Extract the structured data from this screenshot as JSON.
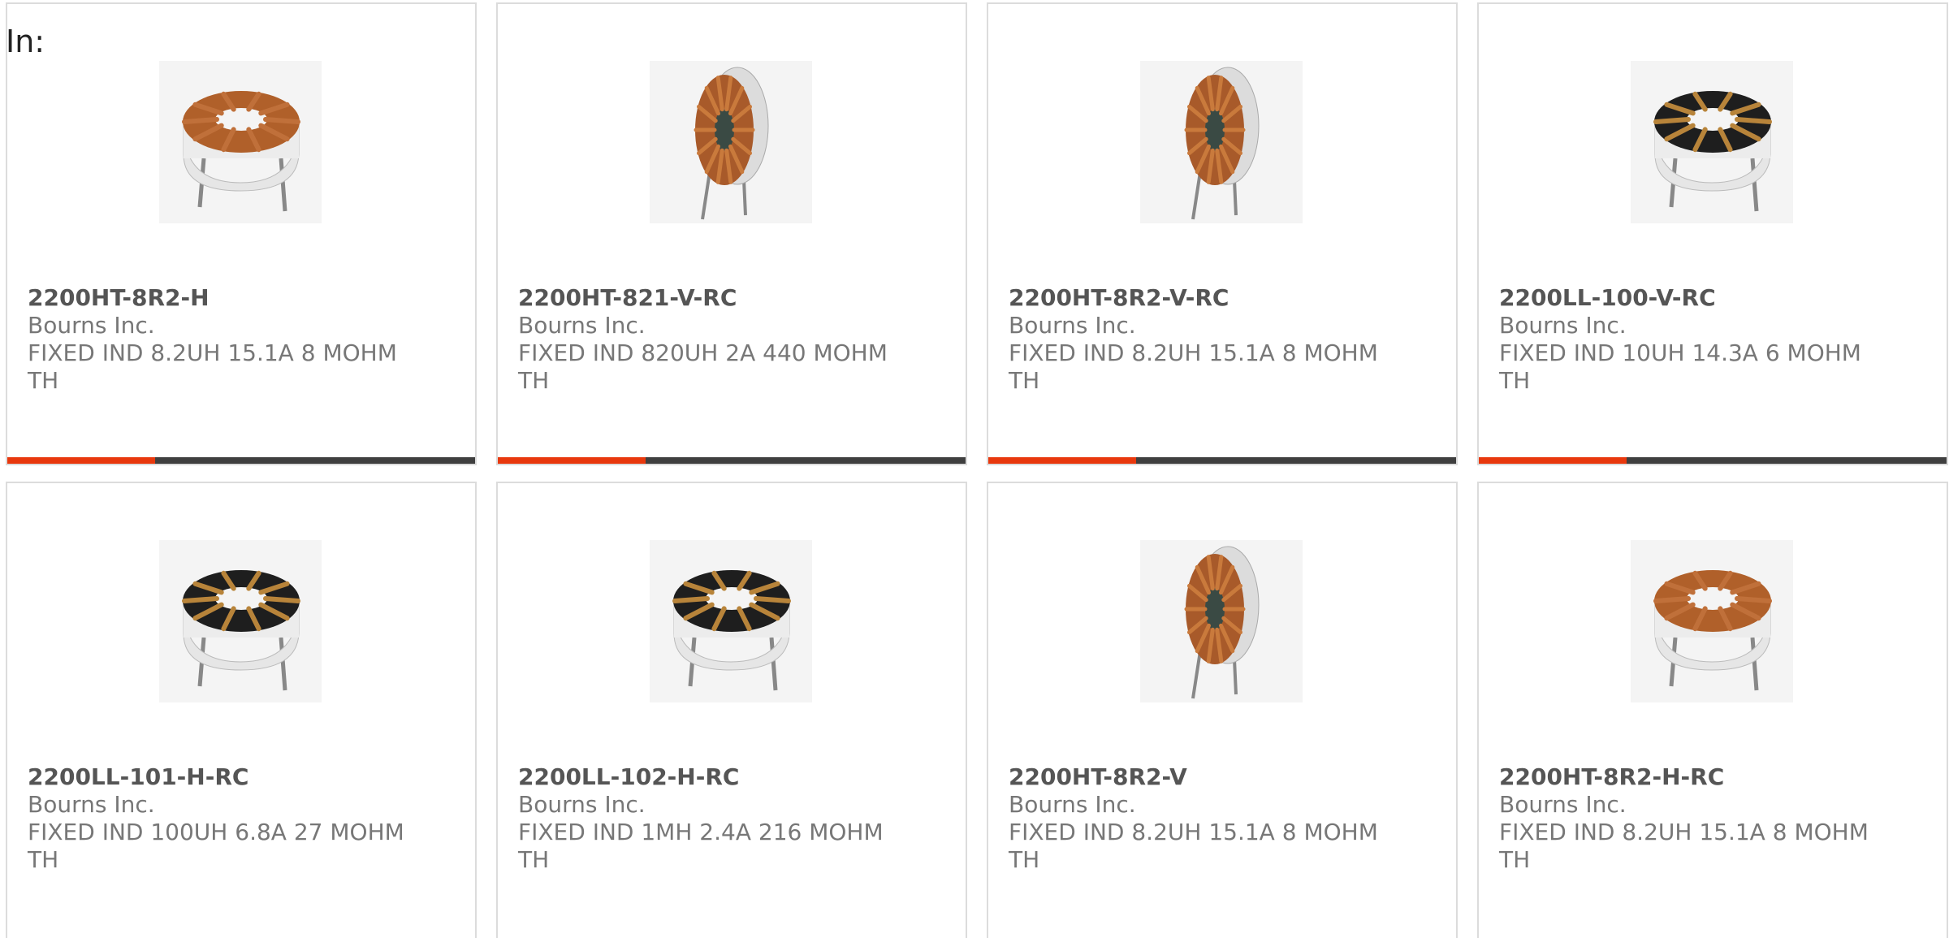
{
  "in_label": "In:",
  "colors": {
    "accent": "#e8380d",
    "bar_dark": "#3f3f3f",
    "border": "#dcdcdc",
    "text_bold": "#555555",
    "text_muted": "#777777"
  },
  "products": [
    {
      "part_number": "2200HT-8R2-H",
      "manufacturer": "Bourns Inc.",
      "description": "FIXED IND 8.2UH 15.1A 8 MOHM TH",
      "image": "toroid-horizontal-copper",
      "show_bar": true
    },
    {
      "part_number": "2200HT-821-V-RC",
      "manufacturer": "Bourns Inc.",
      "description": "FIXED IND 820UH 2A 440 MOHM TH",
      "image": "toroid-vertical",
      "show_bar": true
    },
    {
      "part_number": "2200HT-8R2-V-RC",
      "manufacturer": "Bourns Inc.",
      "description": "FIXED IND 8.2UH 15.1A 8 MOHM TH",
      "image": "toroid-vertical",
      "show_bar": true
    },
    {
      "part_number": "2200LL-100-V-RC",
      "manufacturer": "Bourns Inc.",
      "description": "FIXED IND 10UH 14.3A 6 MOHM TH",
      "image": "toroid-horizontal-dark",
      "show_bar": true
    },
    {
      "part_number": "2200LL-101-H-RC",
      "manufacturer": "Bourns Inc.",
      "description": "FIXED IND 100UH 6.8A 27 MOHM TH",
      "image": "toroid-horizontal-dark",
      "show_bar": false
    },
    {
      "part_number": "2200LL-102-H-RC",
      "manufacturer": "Bourns Inc.",
      "description": "FIXED IND 1MH 2.4A 216 MOHM TH",
      "image": "toroid-horizontal-dark",
      "show_bar": false
    },
    {
      "part_number": "2200HT-8R2-V",
      "manufacturer": "Bourns Inc.",
      "description": "FIXED IND 8.2UH 15.1A 8 MOHM TH",
      "image": "toroid-vertical",
      "show_bar": false
    },
    {
      "part_number": "2200HT-8R2-H-RC",
      "manufacturer": "Bourns Inc.",
      "description": "FIXED IND 8.2UH 15.1A 8 MOHM TH",
      "image": "toroid-horizontal-copper",
      "show_bar": false
    }
  ]
}
